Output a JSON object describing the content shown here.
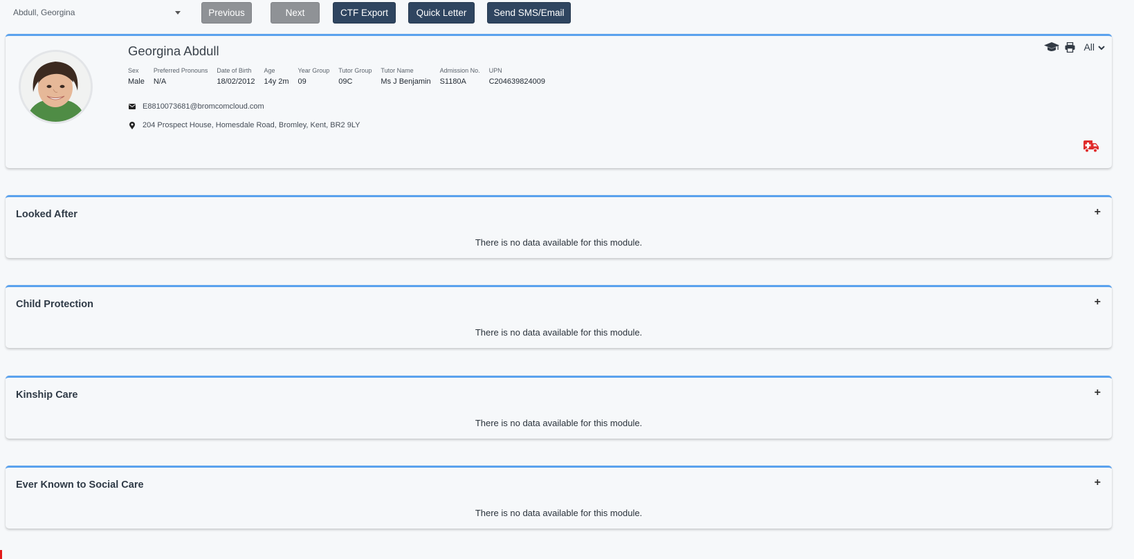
{
  "toolbar": {
    "student_select": "Abdull, Georgina",
    "previous": "Previous",
    "next": "Next",
    "ctf_export": "CTF Export",
    "quick_letter": "Quick Letter",
    "send_sms_email": "Send SMS/Email"
  },
  "profile": {
    "name": "Georgina Abdull",
    "fields": [
      {
        "label": "Sex",
        "value": "Male"
      },
      {
        "label": "Preferred Pronouns",
        "value": "N/A"
      },
      {
        "label": "Date of Birth",
        "value": "18/02/2012"
      },
      {
        "label": "Age",
        "value": "14y 2m"
      },
      {
        "label": "Year Group",
        "value": "09"
      },
      {
        "label": "Tutor Group",
        "value": "09C"
      },
      {
        "label": "Tutor Name",
        "value": "Ms J Benjamin"
      },
      {
        "label": "Admission No.",
        "value": "S1180A"
      },
      {
        "label": "UPN",
        "value": "C204639824009"
      }
    ],
    "email": "E8810073681@bromcomcloud.com",
    "address": "204 Prospect House, Homesdale Road, Bromley, Kent, BR2 9LY",
    "filter_label": "All",
    "icons": [
      "graduation-cap-icon",
      "print-icon",
      "chevron-down-icon",
      "envelope-icon",
      "map-pin-icon",
      "ambulance-icon"
    ],
    "colors": {
      "accent": "#5aa2ee",
      "primary_button": "#2f4560",
      "disabled_button": "#8f9296",
      "alert": "#e02b2b"
    }
  },
  "modules": [
    {
      "title": "Looked After",
      "empty": "There is no data available for this module."
    },
    {
      "title": "Child Protection",
      "empty": "There is no data available for this module."
    },
    {
      "title": "Kinship Care",
      "empty": "There is no data available for this module."
    },
    {
      "title": "Ever Known to Social Care",
      "empty": "There is no data available for this module."
    }
  ],
  "expand_symbol": "+"
}
